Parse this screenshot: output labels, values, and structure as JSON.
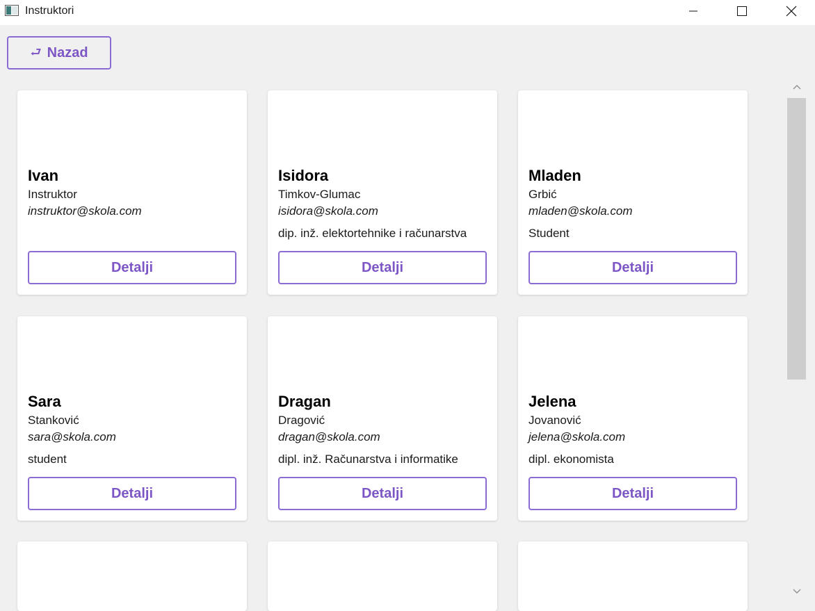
{
  "window": {
    "title": "Instruktori",
    "controls": [
      "minimize-icon",
      "maximize-icon",
      "close-icon"
    ]
  },
  "toolbar": {
    "back_icon": "⮐",
    "back_label": "Nazad"
  },
  "colors": {
    "accent": "#7d56c6",
    "border": "#8a6ad3",
    "background": "#f0f0f0",
    "card": "#ffffff"
  },
  "instructors": [
    {
      "first_name": "Ivan",
      "last_name": "Instruktor",
      "email": "instruktor@skola.com",
      "title": "",
      "details_label": "Detalji"
    },
    {
      "first_name": "Isidora",
      "last_name": "Timkov-Glumac",
      "email": "isidora@skola.com",
      "title": "dip. inž. elektortehnike i računarstva",
      "details_label": "Detalji"
    },
    {
      "first_name": "Mladen",
      "last_name": "Grbić",
      "email": "mladen@skola.com",
      "title": "Student",
      "details_label": "Detalji"
    },
    {
      "first_name": "Sara",
      "last_name": "Stanković",
      "email": "sara@skola.com",
      "title": "student",
      "details_label": "Detalji"
    },
    {
      "first_name": "Dragan",
      "last_name": "Dragović",
      "email": "dragan@skola.com",
      "title": "dipl. inž. Računarstva i informatike",
      "details_label": "Detalji"
    },
    {
      "first_name": "Jelena",
      "last_name": "Jovanović",
      "email": "jelena@skola.com",
      "title": "dipl. ekonomista",
      "details_label": "Detalji"
    }
  ]
}
